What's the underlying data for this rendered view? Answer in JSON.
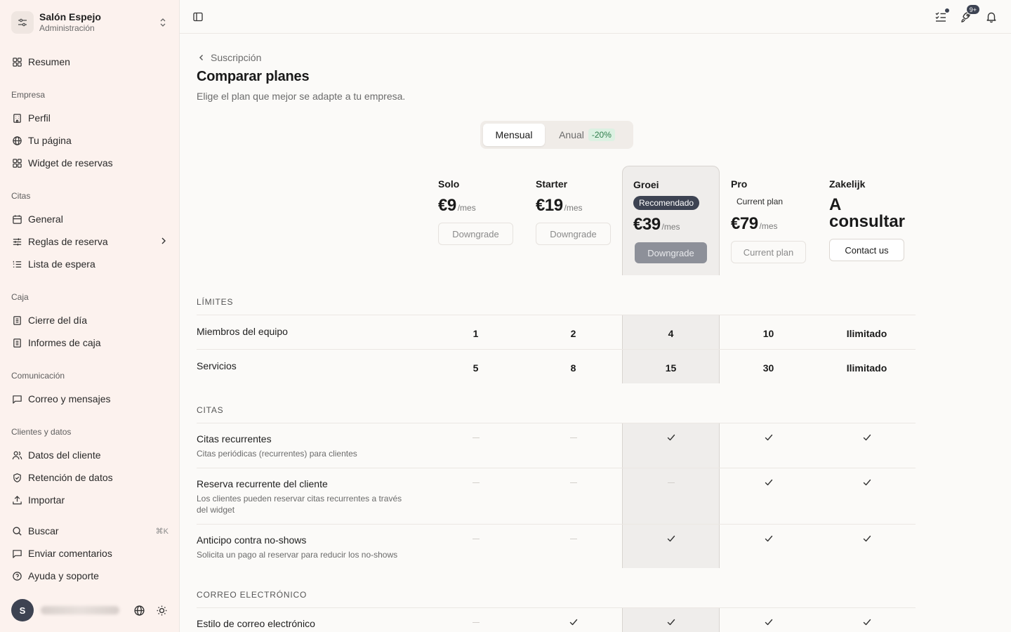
{
  "sidebar": {
    "org_name": "Salón Espejo",
    "org_sub": "Administración",
    "summary": "Resumen",
    "sections": {
      "empresa": "Empresa",
      "citas": "Citas",
      "caja": "Caja",
      "comunicacion": "Comunicación",
      "clientes": "Clientes y datos"
    },
    "items": {
      "perfil": "Perfil",
      "tu_pagina": "Tu página",
      "widget": "Widget de reservas",
      "general": "General",
      "reglas": "Reglas de reserva",
      "lista": "Lista de espera",
      "cierre": "Cierre del día",
      "informes": "Informes de caja",
      "correo": "Correo y mensajes",
      "datos_cliente": "Datos del cliente",
      "retencion": "Retención de datos",
      "importar": "Importar",
      "buscar": "Buscar",
      "buscar_kbd": "⌘K",
      "comentarios": "Enviar comentarios",
      "ayuda": "Ayuda y soporte"
    },
    "user_initial": "S"
  },
  "topbar": {
    "rocket_badge": "9+"
  },
  "main": {
    "breadcrumb": "Suscripción",
    "title": "Comparar planes",
    "subtitle": "Elige el plan que mejor se adapte a tu empresa.",
    "billing": {
      "monthly": "Mensual",
      "annual": "Anual",
      "annual_discount": "-20%"
    },
    "plans": [
      {
        "name": "Solo",
        "price": "€9",
        "period": "/mes",
        "button": "Downgrade"
      },
      {
        "name": "Starter",
        "price": "€19",
        "period": "/mes",
        "button": "Downgrade"
      },
      {
        "name": "Groei",
        "badge": "Recomendado",
        "price": "€39",
        "period": "/mes",
        "button": "Downgrade"
      },
      {
        "name": "Pro",
        "badge": "Current plan",
        "price": "€79",
        "period": "/mes",
        "button": "Current plan"
      },
      {
        "name": "Zakelijk",
        "price": "A consultar",
        "button": "Contact us"
      }
    ],
    "sections": {
      "limits": "LÍMITES",
      "citas": "CITAS",
      "email": "CORREO ELECTRÓNICO"
    },
    "limits_rows": [
      {
        "label": "Miembros del equipo",
        "values": [
          "1",
          "2",
          "4",
          "10",
          "Ilimitado"
        ]
      },
      {
        "label": "Servicios",
        "values": [
          "5",
          "8",
          "15",
          "30",
          "Ilimitado"
        ]
      }
    ],
    "citas_rows": [
      {
        "label": "Citas recurrentes",
        "desc": "Citas periódicas (recurrentes) para clientes",
        "values": [
          false,
          false,
          true,
          true,
          true
        ]
      },
      {
        "label": "Reserva recurrente del cliente",
        "desc": "Los clientes pueden reservar citas recurrentes a través del widget",
        "values": [
          false,
          false,
          false,
          true,
          true
        ]
      },
      {
        "label": "Anticipo contra no-shows",
        "desc": "Solicita un pago al reservar para reducir los no-shows",
        "values": [
          false,
          false,
          true,
          true,
          true
        ]
      }
    ],
    "email_rows": [
      {
        "label": "Estilo de correo electrónico",
        "values": [
          false,
          true,
          true,
          true,
          true
        ]
      }
    ]
  }
}
